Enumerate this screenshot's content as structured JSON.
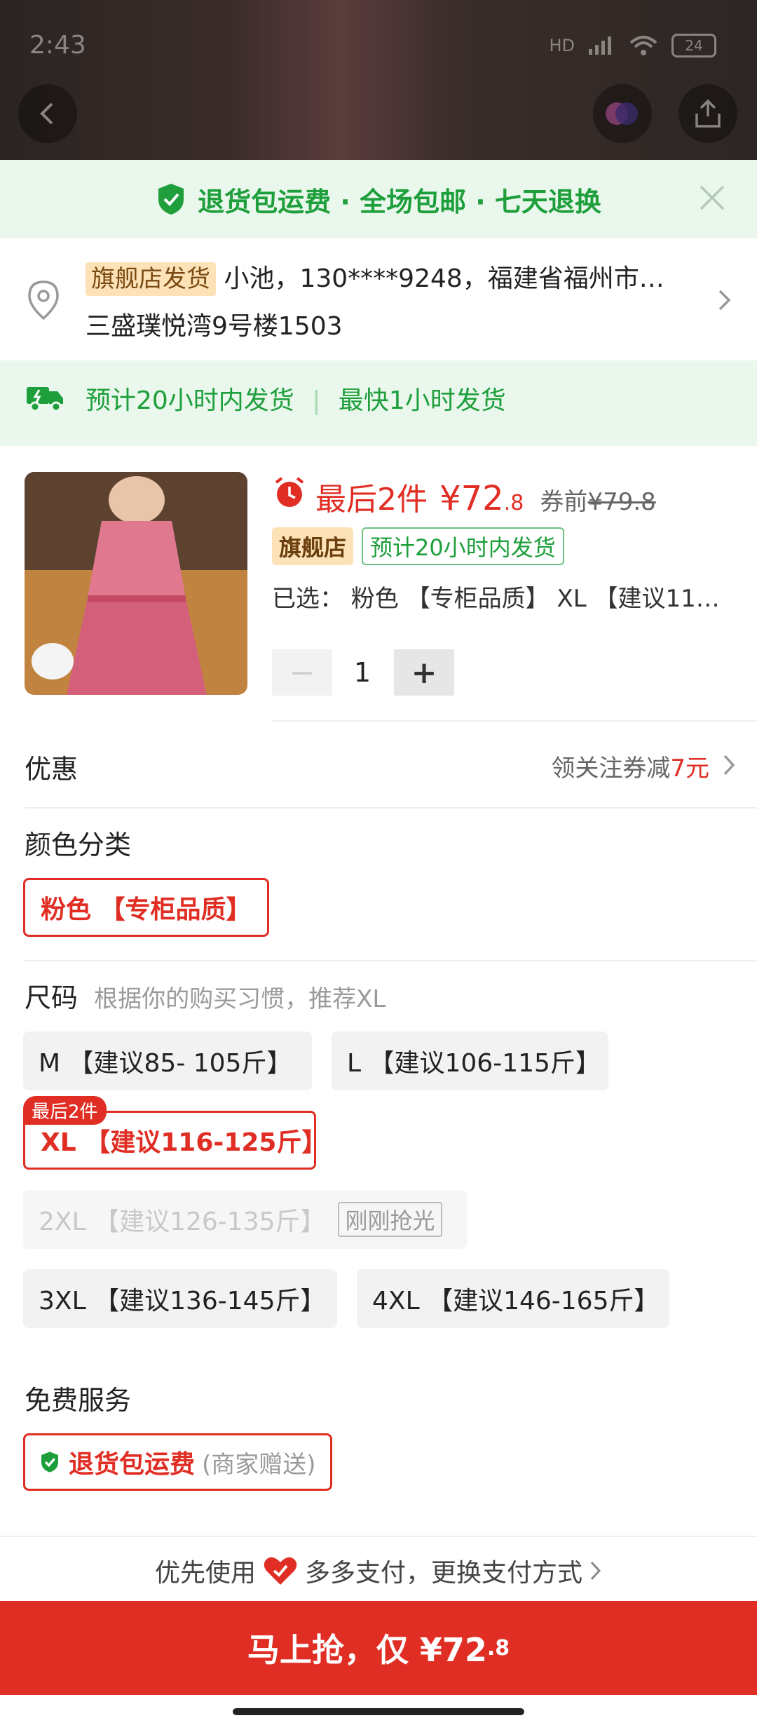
{
  "status": {
    "time": "2:43",
    "battery": "24",
    "signal": "HD"
  },
  "banner": {
    "text": "退货包运费 · 全场包邮 · 七天退换"
  },
  "address": {
    "tag": "旗舰店发货",
    "line1": "小池，130****9248，福建省福州市…",
    "line2": "三盛璞悦湾9号楼1503"
  },
  "delivery": {
    "primary": "预计20小时内发货",
    "secondary": "最快1小时发货"
  },
  "product": {
    "stock_note": "最后2件",
    "price_main": "¥72",
    "price_decimal": ".8",
    "original_label": "券前",
    "original_price": "¥79.8",
    "shop_tag": "旗舰店",
    "ship_tag": "预计20小时内发货",
    "selected": "已选：  粉色 【专柜品质】 XL 【建议11…",
    "quantity": "1",
    "minus": "−",
    "plus": "+"
  },
  "discount": {
    "label": "优惠",
    "value_prefix": "领关注券减",
    "value_amount": "7元"
  },
  "color": {
    "title": "颜色分类",
    "option": "粉色 【专柜品质】"
  },
  "size": {
    "title": "尺码",
    "hint": "根据你的购买习惯，推荐XL",
    "options": [
      {
        "label": "M 【建议85- 105斤】"
      },
      {
        "label": "L 【建议106-115斤】"
      },
      {
        "label": "XL 【建议116-125斤】",
        "badge": "最后2件"
      },
      {
        "label": "2XL 【建议126-135斤】",
        "badge": "刚刚抢光"
      },
      {
        "label": "3XL 【建议136-145斤】"
      },
      {
        "label": "4XL 【建议146-165斤】"
      }
    ]
  },
  "service": {
    "title": "免费服务",
    "name": "退货包运费",
    "note": "(商家赠送)"
  },
  "payment": {
    "prefix": "优先使用",
    "text": "多多支付，更换支付方式"
  },
  "cta": {
    "prefix": "马上抢，仅 ¥72",
    "decimal": ".8"
  },
  "colors": {
    "accent_red": "#e02e24",
    "green": "#1e9f3b",
    "green_bg": "#e9f7ec"
  },
  "icons": [
    "back-icon",
    "share-icon",
    "shield-check-icon",
    "close-icon",
    "location-pin-icon",
    "chevron-right-icon",
    "truck-icon",
    "alarm-icon",
    "heart-shield-icon"
  ]
}
